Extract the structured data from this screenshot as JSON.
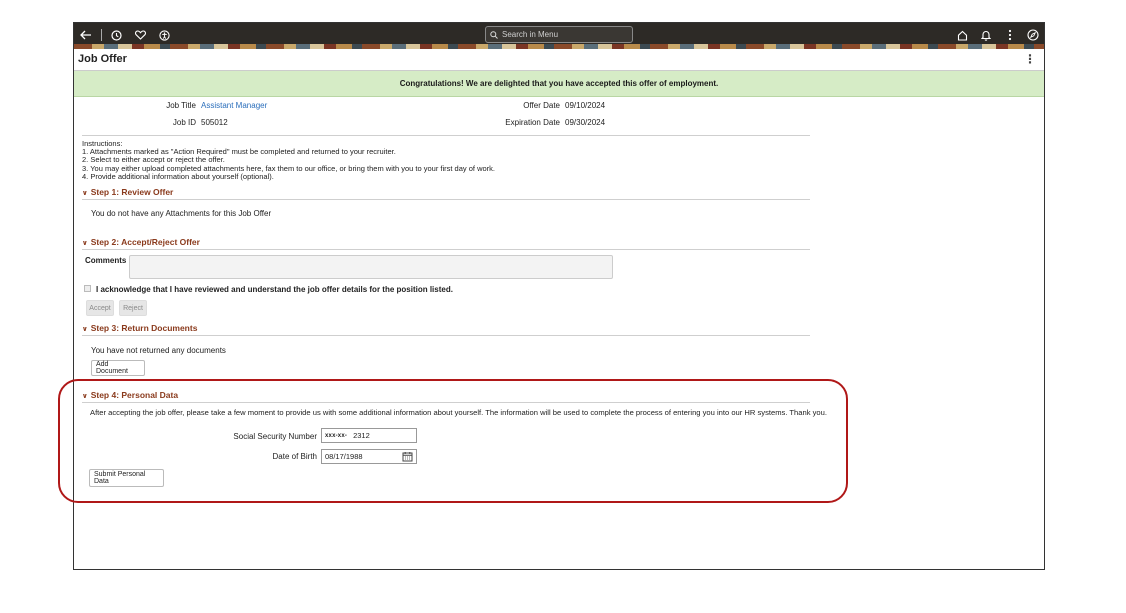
{
  "topbar": {
    "search_placeholder": "Search in Menu",
    "icons": [
      "back-icon",
      "history-icon",
      "favorites-icon",
      "accessibility-icon",
      "home-icon",
      "notification-icon",
      "actions-menu-icon",
      "navbar-icon"
    ]
  },
  "page": {
    "title": "Job Offer",
    "menu_glyph": "⋮"
  },
  "banner": {
    "message": "Congratulations! We are delighted that you have accepted this offer of employment."
  },
  "details": {
    "job_title_label": "Job Title",
    "job_title_value": "Assistant Manager",
    "job_id_label": "Job ID",
    "job_id_value": "505012",
    "offer_date_label": "Offer Date",
    "offer_date_value": "09/10/2024",
    "expiration_date_label": "Expiration Date",
    "expiration_date_value": "09/30/2024"
  },
  "instructions": {
    "heading": "Instructions:",
    "lines": [
      "1. Attachments marked as \"Action Required\" must be completed and returned to your recruiter.",
      "2. Select to either accept or reject the offer.",
      "3. You may either upload completed attachments here, fax them to our office, or bring them with you to your first day of work.",
      "4. Provide additional information about yourself (optional)."
    ]
  },
  "step1": {
    "title": "Step 1: Review Offer",
    "text": "You do not have any Attachments for this Job Offer"
  },
  "step2": {
    "title": "Step 2: Accept/Reject Offer",
    "comments_label": "Comments",
    "acknowledge_text": "I acknowledge that I have reviewed and understand the job offer details for the position listed.",
    "accept_label": "Accept",
    "reject_label": "Reject"
  },
  "step3": {
    "title": "Step 3: Return Documents",
    "text": "You have not returned any documents",
    "add_document_label": "Add Document"
  },
  "step4": {
    "title": "Step 4: Personal Data",
    "text": "After accepting the job offer, please take a few moment to provide us with some additional information about yourself. The information will be used to complete the process of entering you into our HR systems. Thank you.",
    "ssn_label": "Social Security Number",
    "ssn_mask": "xxx-xx-",
    "ssn_value": "2312",
    "dob_label": "Date of Birth",
    "dob_value": "08/17/1988",
    "submit_label": "Submit Personal Data"
  },
  "colors": {
    "step_heading": "#8a3a1c",
    "banner_bg": "#d6ecc6",
    "link": "#2a6ebb",
    "highlight": "#b01818"
  }
}
